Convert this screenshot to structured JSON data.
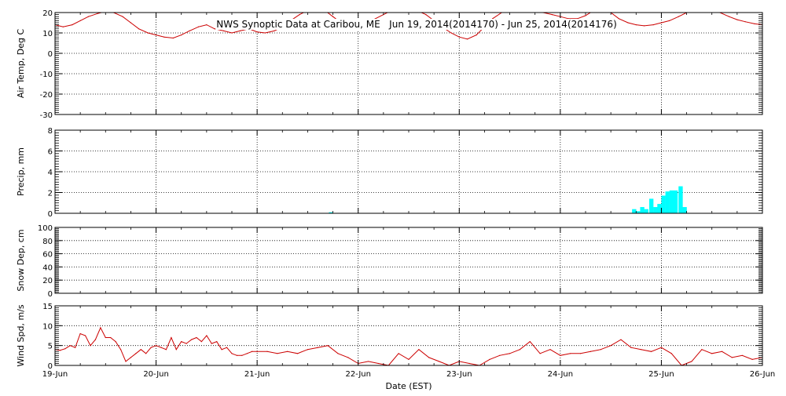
{
  "page_title": "NWS Synoptic Data at Caribou, ME   Jun 19, 2014(2014170) - Jun 25, 2014(2014176)",
  "x_axis": {
    "label": "Date (EST)",
    "ticks": [
      "19-Jun",
      "20-Jun",
      "21-Jun",
      "22-Jun",
      "23-Jun",
      "24-Jun",
      "25-Jun",
      "26-Jun"
    ],
    "range_days": [
      0,
      7
    ]
  },
  "colors": {
    "temperature": "#cc0000",
    "precip": "#00ffff",
    "wind": "#cc0000",
    "axes": "#000000"
  },
  "chart_data": [
    {
      "id": "air-temp",
      "type": "line",
      "ylabel": "Air Temp, Deg C",
      "ylim": [
        -30,
        20
      ],
      "yticks": [
        -30,
        -20,
        -10,
        0,
        10,
        20
      ],
      "grid": true,
      "series": [
        {
          "x": [
            0,
            0.08,
            0.17,
            0.25,
            0.33,
            0.42,
            0.5,
            0.58,
            0.67,
            0.75,
            0.83,
            0.92,
            1.0,
            1.08,
            1.17,
            1.25,
            1.33,
            1.42,
            1.5,
            1.58,
            1.67,
            1.75,
            1.83,
            1.92,
            2.0,
            2.08,
            2.17,
            2.25,
            2.33,
            2.42,
            2.5,
            2.58,
            2.67,
            2.75,
            2.83,
            2.92,
            3.0,
            3.08,
            3.17,
            3.25,
            3.33,
            3.42,
            3.5,
            3.58,
            3.67,
            3.75,
            3.83,
            3.92,
            4.0,
            4.08,
            4.17,
            4.25,
            4.33,
            4.42,
            4.5,
            4.58,
            4.67,
            4.75,
            4.83,
            4.92,
            5.0,
            5.08,
            5.17,
            5.25,
            5.33,
            5.42,
            5.5,
            5.58,
            5.67,
            5.75,
            5.83,
            5.92,
            6.0,
            6.08,
            6.17,
            6.25,
            6.33,
            6.42,
            6.5,
            6.58,
            6.67,
            6.75,
            6.83,
            6.92,
            7.0
          ],
          "y": [
            14,
            13,
            14,
            16,
            18,
            19.5,
            20.5,
            20,
            18,
            15,
            12,
            10,
            9,
            8,
            7.5,
            9,
            11,
            13,
            14,
            12,
            11,
            10,
            11,
            12,
            10.5,
            10,
            11,
            13,
            16,
            19,
            21,
            22,
            21,
            18,
            15,
            14,
            14,
            15,
            17,
            19,
            21,
            22,
            22.5,
            21,
            19,
            16,
            13,
            10,
            8,
            7,
            9,
            13,
            17,
            20,
            22,
            22.5,
            22,
            21,
            20,
            19,
            18,
            17,
            17,
            18.5,
            21,
            22,
            20,
            17,
            15,
            14,
            13.5,
            14,
            15,
            16,
            18,
            20,
            22,
            23,
            22,
            20,
            18,
            16.5,
            15.5,
            14.5,
            14
          ]
        }
      ]
    },
    {
      "id": "precip",
      "type": "bar",
      "ylabel": "Precip, mm",
      "ylim": [
        0,
        8
      ],
      "yticks": [
        0,
        2,
        4,
        6,
        8
      ],
      "grid": true,
      "bar_width_days": 0.0417,
      "x": [
        2.71,
        5.71,
        5.75,
        5.79,
        5.83,
        5.88,
        5.92,
        5.96,
        6.0,
        6.04,
        6.08,
        6.12,
        6.17,
        6.21
      ],
      "values": [
        0.1,
        0.4,
        0.2,
        0.6,
        0.4,
        1.4,
        0.6,
        0.9,
        1.7,
        2.1,
        2.2,
        2.2,
        2.6,
        0.6
      ]
    },
    {
      "id": "snow-depth",
      "type": "line",
      "ylabel": "Snow Dep, cm",
      "ylim": [
        0,
        100
      ],
      "yticks": [
        0,
        20,
        40,
        60,
        80,
        100
      ],
      "grid": true,
      "series": []
    },
    {
      "id": "wind-speed",
      "type": "line",
      "ylabel": "Wind Spd, m/s",
      "ylim": [
        0,
        15
      ],
      "yticks": [
        0,
        5,
        10,
        15
      ],
      "grid": true,
      "series": [
        {
          "x": [
            0,
            0.05,
            0.1,
            0.15,
            0.2,
            0.25,
            0.3,
            0.35,
            0.4,
            0.45,
            0.5,
            0.55,
            0.6,
            0.65,
            0.7,
            0.75,
            0.8,
            0.85,
            0.9,
            0.95,
            1.0,
            1.05,
            1.1,
            1.15,
            1.2,
            1.25,
            1.3,
            1.35,
            1.4,
            1.45,
            1.5,
            1.55,
            1.6,
            1.65,
            1.7,
            1.75,
            1.8,
            1.85,
            1.9,
            1.95,
            2.0,
            2.1,
            2.2,
            2.3,
            2.4,
            2.5,
            2.6,
            2.7,
            2.8,
            2.9,
            3.0,
            3.1,
            3.2,
            3.3,
            3.4,
            3.5,
            3.6,
            3.7,
            3.8,
            3.9,
            4.0,
            4.1,
            4.2,
            4.3,
            4.4,
            4.5,
            4.6,
            4.7,
            4.8,
            4.9,
            5.0,
            5.1,
            5.2,
            5.3,
            5.4,
            5.5,
            5.6,
            5.7,
            5.8,
            5.9,
            6.0,
            6.1,
            6.2,
            6.3,
            6.4,
            6.5,
            6.6,
            6.7,
            6.8,
            6.9,
            7.0
          ],
          "y": [
            4,
            3.8,
            4.2,
            5,
            4.5,
            8,
            7.5,
            5,
            6.5,
            9.5,
            7,
            7,
            6,
            4,
            1,
            2,
            3,
            4,
            3,
            4.5,
            5,
            4.5,
            4,
            7,
            4,
            6,
            5.5,
            6.5,
            7,
            6,
            7.5,
            5.5,
            6,
            4,
            4.5,
            3,
            2.5,
            2.5,
            3,
            3.5,
            3.5,
            3.5,
            3,
            3.5,
            3,
            4,
            4.5,
            5,
            3,
            2,
            0.5,
            1,
            0.5,
            0,
            3,
            1.5,
            4,
            2,
            1,
            0,
            1,
            0.5,
            0,
            1.5,
            2.5,
            3,
            4,
            6,
            3,
            4,
            2.5,
            3,
            3,
            3.5,
            4,
            5,
            6.5,
            4.5,
            4,
            3.5,
            4.5,
            3,
            0,
            1,
            4,
            3,
            3.5,
            2,
            2.5,
            1.5,
            2
          ]
        }
      ]
    }
  ]
}
